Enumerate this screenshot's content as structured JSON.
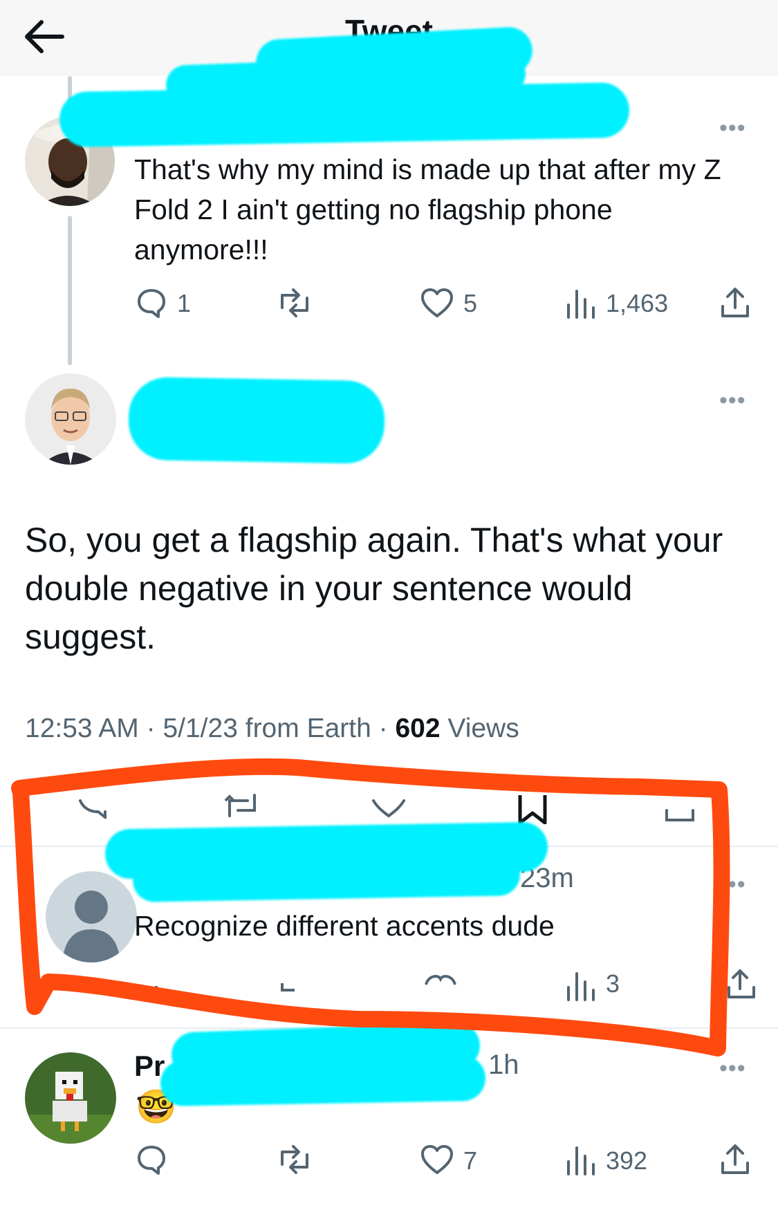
{
  "header": {
    "title": "Tweet"
  },
  "parent_tweet": {
    "text": "That's why my mind is made up that after my Z Fold 2 I ain't getting no flagship phone anymore!!!",
    "replies": "1",
    "likes": "5",
    "views": "1,463"
  },
  "main_tweet": {
    "text": "So, you get a flagship again. That's what your double negative in your sentence would suggest.",
    "time": "12:53 AM",
    "date": "5/1/23",
    "source": "from Earth",
    "views_count": "602",
    "views_label": "Views"
  },
  "replies": [
    {
      "time": "23m",
      "text": "Recognize different accents dude",
      "views": "3"
    },
    {
      "name_prefix": "Pr",
      "time": "1h",
      "emoji": "🤓",
      "likes": "7",
      "views": "392"
    }
  ],
  "colors": {
    "redaction": "#00f0ff",
    "annotation": "#ff4a0f",
    "muted": "#536471"
  }
}
